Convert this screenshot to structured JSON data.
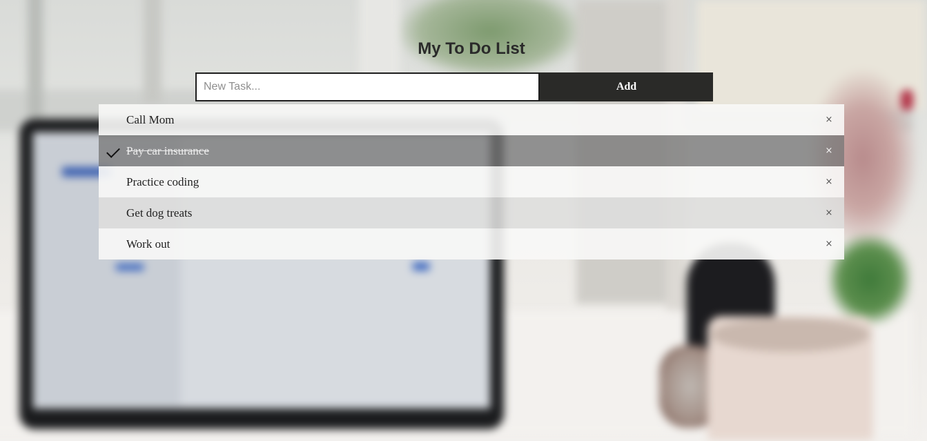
{
  "app": {
    "title": "My To Do List"
  },
  "form": {
    "input_value": "",
    "input_placeholder": "New Task...",
    "add_label": "Add"
  },
  "tasks": [
    {
      "label": "Call Mom",
      "checked": false,
      "close_label": "×"
    },
    {
      "label": "Pay car insurance",
      "checked": true,
      "close_label": "×"
    },
    {
      "label": "Practice coding",
      "checked": false,
      "close_label": "×"
    },
    {
      "label": "Get dog treats",
      "checked": false,
      "close_label": "×"
    },
    {
      "label": "Work out",
      "checked": false,
      "close_label": "×"
    }
  ],
  "icons": {
    "check": "check-icon",
    "close": "close-icon"
  }
}
